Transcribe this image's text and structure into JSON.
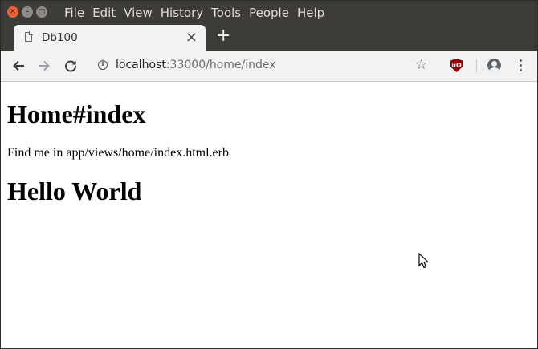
{
  "window": {
    "menu": [
      "File",
      "Edit",
      "View",
      "History",
      "Tools",
      "People",
      "Help"
    ]
  },
  "tab": {
    "title": "Db100"
  },
  "address_bar": {
    "host": "localhost",
    "path": ":33000/home/index"
  },
  "page": {
    "heading": "Home#index",
    "paragraph": "Find me in app/views/home/index.html.erb",
    "heading2": "Hello World"
  }
}
